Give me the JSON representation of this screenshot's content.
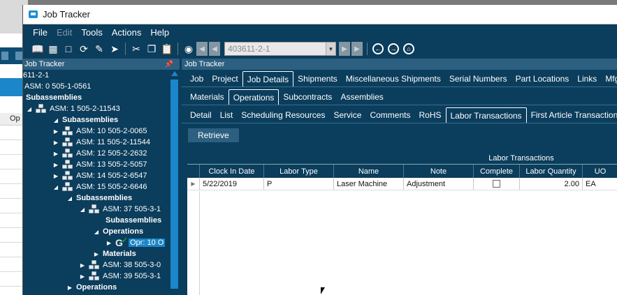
{
  "background_app": {
    "header_fragment": "Op"
  },
  "window": {
    "title": "Job Tracker"
  },
  "menu": {
    "items": [
      {
        "label": "File",
        "enabled": true
      },
      {
        "label": "Edit",
        "enabled": false
      },
      {
        "label": "Tools",
        "enabled": true
      },
      {
        "label": "Actions",
        "enabled": true
      },
      {
        "label": "Help",
        "enabled": true
      }
    ]
  },
  "toolbar": {
    "job_number": "403611-2-1"
  },
  "left_panel": {
    "title": "Job Tracker",
    "tree": [
      {
        "label": "611-2-1",
        "type": "text",
        "bold": false
      },
      {
        "label": "ASM: 0 505-1-0561",
        "type": "text",
        "bold": false
      },
      {
        "label": "Subassemblies",
        "type": "text",
        "bold": true
      },
      {
        "label": "ASM: 1 505-2-11543",
        "type": "asm",
        "bold": false
      },
      {
        "label": "Subassemblies",
        "type": "text",
        "bold": true
      },
      {
        "label": "ASM: 10 505-2-0065",
        "type": "asm",
        "bold": false
      },
      {
        "label": "ASM: 11 505-2-11544",
        "type": "asm",
        "bold": false
      },
      {
        "label": "ASM: 12 505-2-2632",
        "type": "asm",
        "bold": false
      },
      {
        "label": "ASM: 13 505-2-5057",
        "type": "asm",
        "bold": false
      },
      {
        "label": "ASM: 14 505-2-6547",
        "type": "asm",
        "bold": false
      },
      {
        "label": "ASM: 15 505-2-6646",
        "type": "asm",
        "bold": false
      },
      {
        "label": "Subassemblies",
        "type": "text",
        "bold": true
      },
      {
        "label": "ASM: 37 505-3-1",
        "type": "asm",
        "bold": false
      },
      {
        "label": "Subassemblies",
        "type": "text",
        "bold": true
      },
      {
        "label": "Operations",
        "type": "text",
        "bold": true
      },
      {
        "label": "Opr: 10 O",
        "type": "opr",
        "bold": false
      },
      {
        "label": "Materials",
        "type": "text",
        "bold": true
      },
      {
        "label": "ASM: 38 505-3-0",
        "type": "asm",
        "bold": false
      },
      {
        "label": "ASM: 39 505-3-1",
        "type": "asm",
        "bold": false
      },
      {
        "label": "Operations",
        "type": "text",
        "bold": true
      }
    ]
  },
  "right_panel": {
    "title": "Job Tracker",
    "tabs_row1": [
      "Job",
      "Project",
      "Job Details",
      "Shipments",
      "Miscellaneous Shipments",
      "Serial Numbers",
      "Part Locations",
      "Links",
      "Mfg. R"
    ],
    "tabs_row2": [
      "Materials",
      "Operations",
      "Subcontracts",
      "Assemblies"
    ],
    "tabs_row3": [
      "Detail",
      "List",
      "Scheduling Resources",
      "Service",
      "Comments",
      "RoHS",
      "Labor Transactions",
      "First Article Transactions"
    ],
    "retrieve_label": "Retrieve",
    "grid": {
      "title": "Labor Transactions",
      "columns": [
        "Clock In Date",
        "Labor Type",
        "Name",
        "Note",
        "Complete",
        "Labor Quantity",
        "UO"
      ],
      "rows": [
        {
          "clock_in_date": "5/22/2019",
          "labor_type": "P",
          "name": "Laser Machine",
          "note": "Adjustment",
          "complete": false,
          "labor_quantity": "2.00",
          "uom": "EA"
        }
      ]
    }
  }
}
